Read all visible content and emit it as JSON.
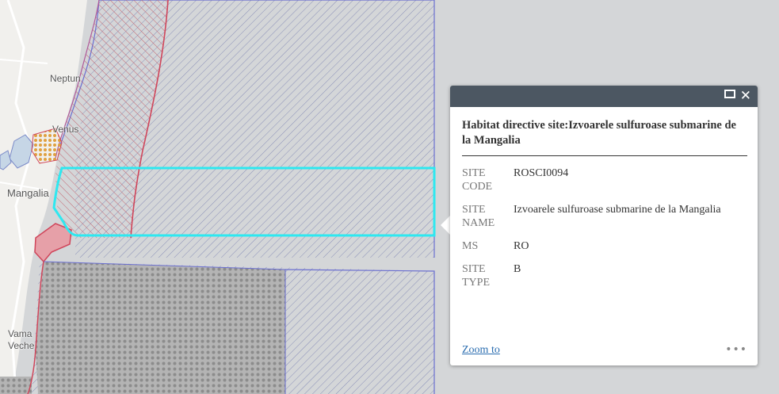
{
  "map": {
    "places": [
      {
        "label": "Neptun"
      },
      {
        "label": "Venus"
      },
      {
        "label": "Mangalia"
      },
      {
        "label": "Vama"
      },
      {
        "label": "Veche"
      }
    ],
    "colors": {
      "sea": "#d4d6d8",
      "land": "#f1f0ed",
      "hatch_blue": "#8a90b8",
      "hatch_red": "#c25a66",
      "boundary_red": "#d0455a",
      "boundary_blue": "#6a6ed0",
      "highlight": "#2ee8f0",
      "pink_zone": "#e6a0a8"
    }
  },
  "popup": {
    "title": "Habitat directive site:Izvoarele sulfuroase submarine de la Mangalia",
    "fields": [
      {
        "key": "SITE CODE",
        "value": "ROSCI0094"
      },
      {
        "key": "SITE NAME",
        "value": "Izvoarele sulfuroase submarine de la Mangalia"
      },
      {
        "key": "MS",
        "value": "RO"
      },
      {
        "key": "SITE TYPE",
        "value": "B"
      }
    ],
    "zoom_label": "Zoom to",
    "more_label": "•••",
    "close_label": "✕"
  }
}
